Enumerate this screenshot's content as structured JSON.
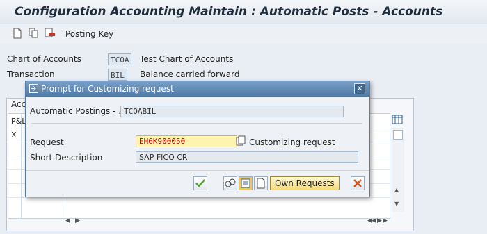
{
  "window": {
    "title": "Configuration Accounting Maintain : Automatic Posts - Accounts"
  },
  "toolbar": {
    "posting_key_label": "Posting Key"
  },
  "header": {
    "chart_of_accounts_label": "Chart of Accounts",
    "chart_of_accounts_value": "TCOA",
    "chart_of_accounts_desc": "Test Chart of Accounts",
    "transaction_label": "Transaction",
    "transaction_value": "BIL",
    "transaction_desc": "Balance carried forward"
  },
  "background_table": {
    "tab_label": "Acc",
    "column_header": "P&L",
    "first_cell": "X"
  },
  "dialog": {
    "title": "Prompt for Customizing request",
    "auto_postings_label": "Automatic Postings - ...",
    "auto_postings_value": "TCOABIL",
    "request_label": "Request",
    "request_value": "EH6K900050",
    "customizing_request_label": "Customizing request",
    "short_description_label": "Short Description",
    "short_description_value": "SAP FICO CR",
    "own_requests_label": "Own Requests"
  },
  "colors": {
    "accent": "#4f79a6",
    "required_field": "#fff3b0",
    "cancel": "#d9541e",
    "ok": "#5aa02c"
  }
}
